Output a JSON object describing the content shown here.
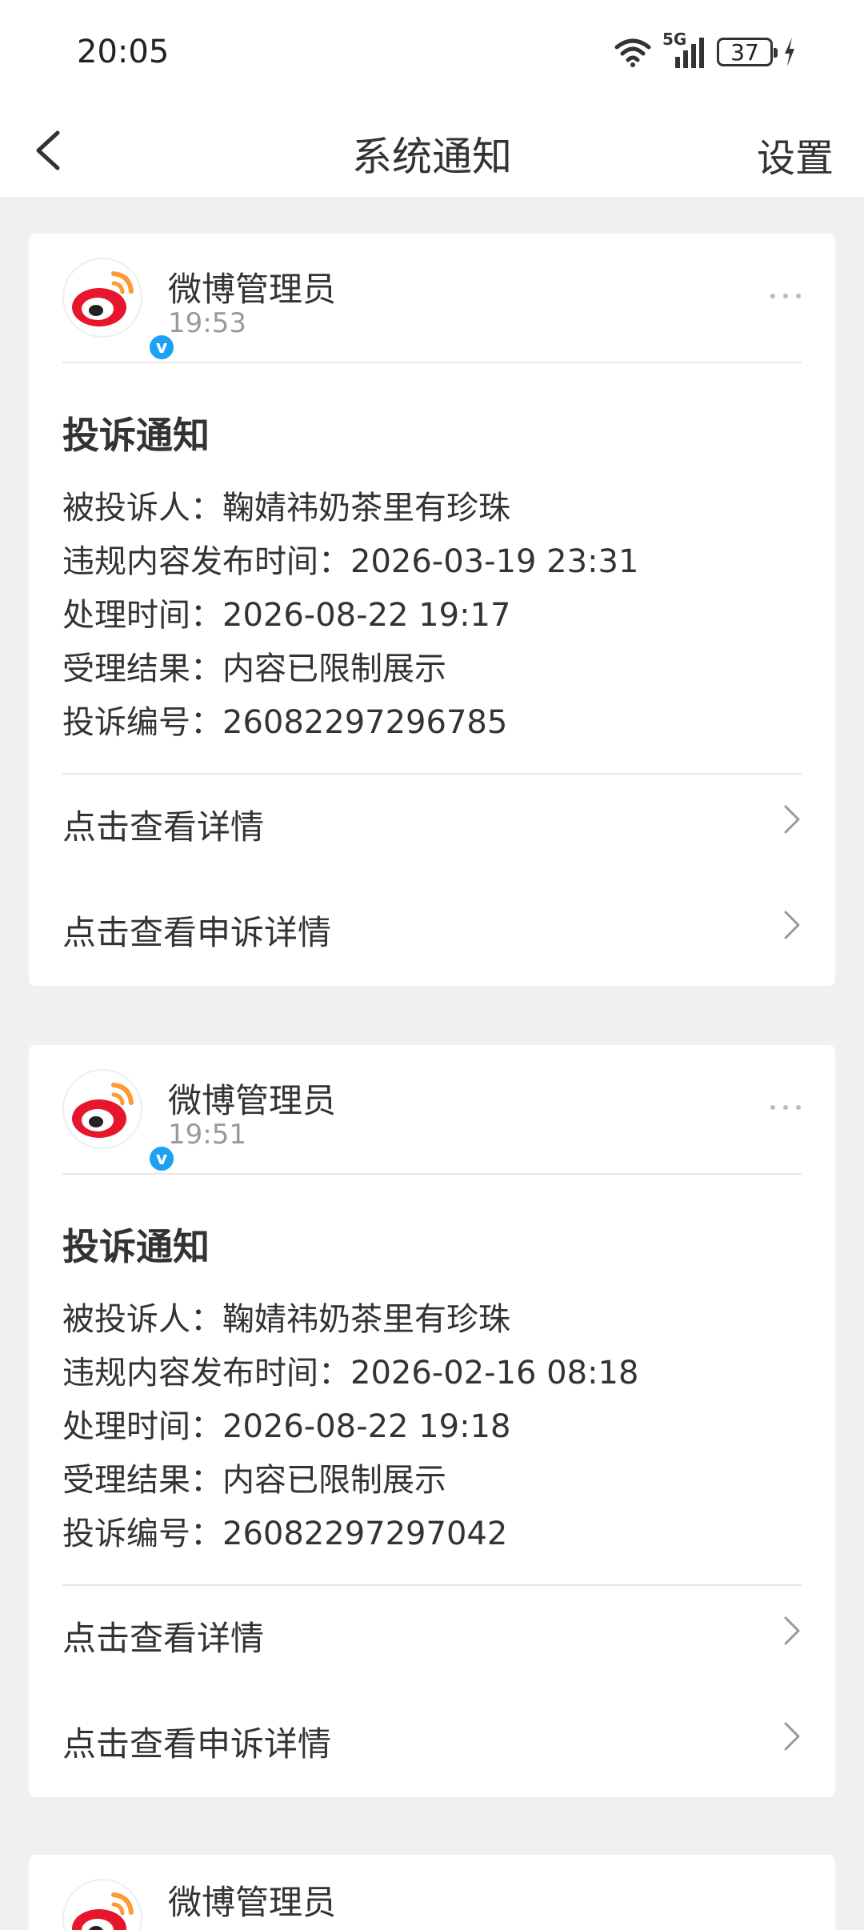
{
  "status_bar": {
    "time": "20:05",
    "network": "5G",
    "battery": "37"
  },
  "nav": {
    "title": "系统通知",
    "settings": "设置"
  },
  "labels": {
    "defendant": "被投诉人：",
    "publish_time": "违规内容发布时间：",
    "handle_time": "处理时间：",
    "result": "受理结果：",
    "complaint_no": "投诉编号："
  },
  "cards": [
    {
      "sender": "微博管理员",
      "time": "19:53",
      "title": "投诉通知",
      "defendant": "鞠婧祎奶茶里有珍珠",
      "publish_time": "2026-03-19 23:31",
      "handle_time": "2026-08-22 19:17",
      "result": "内容已限制展示",
      "complaint_no": "26082297296785",
      "link_details": "点击查看详情",
      "link_appeal": "点击查看申诉详情"
    },
    {
      "sender": "微博管理员",
      "time": "19:51",
      "title": "投诉通知",
      "defendant": "鞠婧祎奶茶里有珍珠",
      "publish_time": "2026-02-16 08:18",
      "handle_time": "2026-08-22 19:18",
      "result": "内容已限制展示",
      "complaint_no": "26082297297042",
      "link_details": "点击查看详情",
      "link_appeal": "点击查看申诉详情"
    },
    {
      "sender": "微博管理员"
    }
  ],
  "colors": {
    "weibo_red": "#e6162d",
    "weibo_orange": "#ff9933",
    "verify_blue": "#1da1f2"
  },
  "icons": [
    "wifi-icon",
    "signal-icon",
    "battery-icon",
    "charging-icon",
    "back-icon",
    "weibo-logo-icon",
    "more-icon",
    "chevron-right-icon"
  ]
}
